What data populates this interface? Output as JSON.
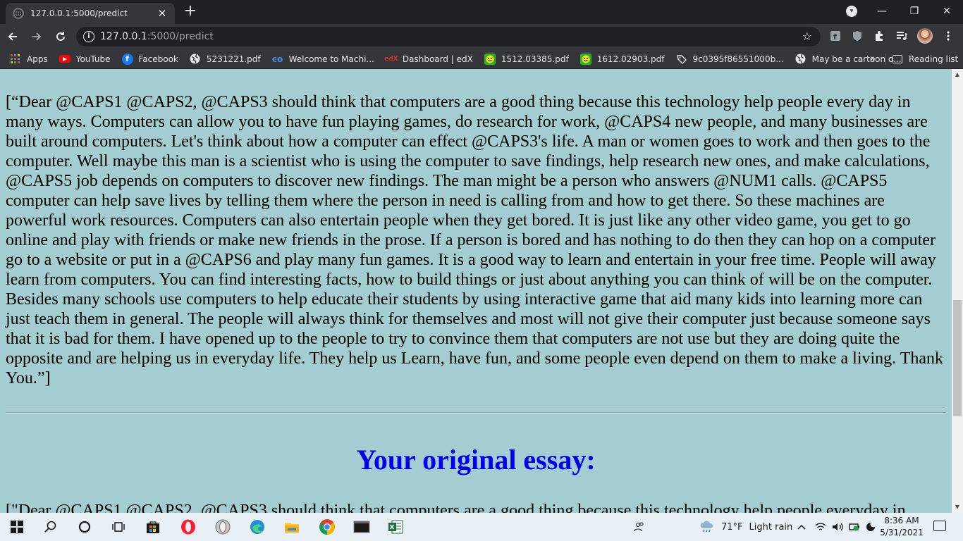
{
  "browser": {
    "tab_title": "127.0.0.1:5000/predict",
    "tab_close": "✕",
    "new_tab": "+",
    "url_host": "127.0.0.1",
    "url_rest": ":5000/predict",
    "window_controls": {
      "minimize": "—",
      "maximize": "❐",
      "close": "✕"
    }
  },
  "bookmarks": {
    "items": [
      {
        "label": "Apps",
        "icon": "apps-grid-icon"
      },
      {
        "label": "YouTube",
        "icon": "youtube-icon"
      },
      {
        "label": "Facebook",
        "icon": "facebook-icon"
      },
      {
        "label": "5231221.pdf",
        "icon": "globe-icon"
      },
      {
        "label": "Welcome to Machi...",
        "icon": "coursera-icon"
      },
      {
        "label": "Dashboard | edX",
        "icon": "edx-icon"
      },
      {
        "label": "1512.03385.pdf",
        "icon": "smiley-icon"
      },
      {
        "label": "1612.02903.pdf",
        "icon": "smiley-icon"
      },
      {
        "label": "9c0395f86551000b...",
        "icon": "tag-icon"
      },
      {
        "label": "May be a cartoon o...",
        "icon": "globe-icon"
      }
    ],
    "more": "»",
    "reading_list": "Reading list"
  },
  "page": {
    "essay_result": "[“Dear @CAPS1 @CAPS2, @CAPS3 should think that computers are a good thing because this technology help people every day in many ways. Computers can allow you to have fun playing games, do research for work, @CAPS4 new people, and many businesses are built around computers. Let's think about how a computer can effect @CAPS3's life. A man or women goes to work and then goes to the computer. Well maybe this man is a scientist who is using the computer to save findings, help research new ones, and make calculations, @CAPS5 job depends on computers to discover new findings. The man might be a person who answers @NUM1 calls. @CAPS5 computer can help save lives by telling them where the person in need is calling from and how to get there. So these machines are powerful work resources. Computers can also entertain people when they get bored. It is just like any other video game, you get to go online and play with friends or make new friends in the prose. If a person is bored and has nothing to do then they can hop on a computer go to a website or put in a @CAPS6 and play many fun games. It is a good way to learn and entertain in your free time. People will away learn from computers. You can find interesting facts, how to build things or just about anything you can think of will be on the computer. Besides many schools use computers to help educate their students by using interactive game that aid many kids into learning more can just teach them in general. The people will always think for themselves and most will not give their computer just because someone says that it is bad for them. I have opened up to the people to try to convince them that computers are not use but they are doing quite the opposite and are helping us in everyday life. They help us Learn, have fun, and some people even depend on them to make a living. Thank You.”]",
    "original_heading": "Your original essay:",
    "original_essay_start": "[\"Dear @CAPS1 @CAPS2, @CAPS3 should think that computers are a good thing because this technology help people everyday in"
  },
  "taskbar": {
    "weather_temp": "71°F",
    "weather_desc": "Light rain",
    "time": "8:36 AM",
    "date": "5/31/2021"
  },
  "colors": {
    "page_bg": "#a3cdd1",
    "heading": "#0000ee",
    "chrome_dark": "#202124",
    "chrome_toolbar": "#35363a"
  }
}
